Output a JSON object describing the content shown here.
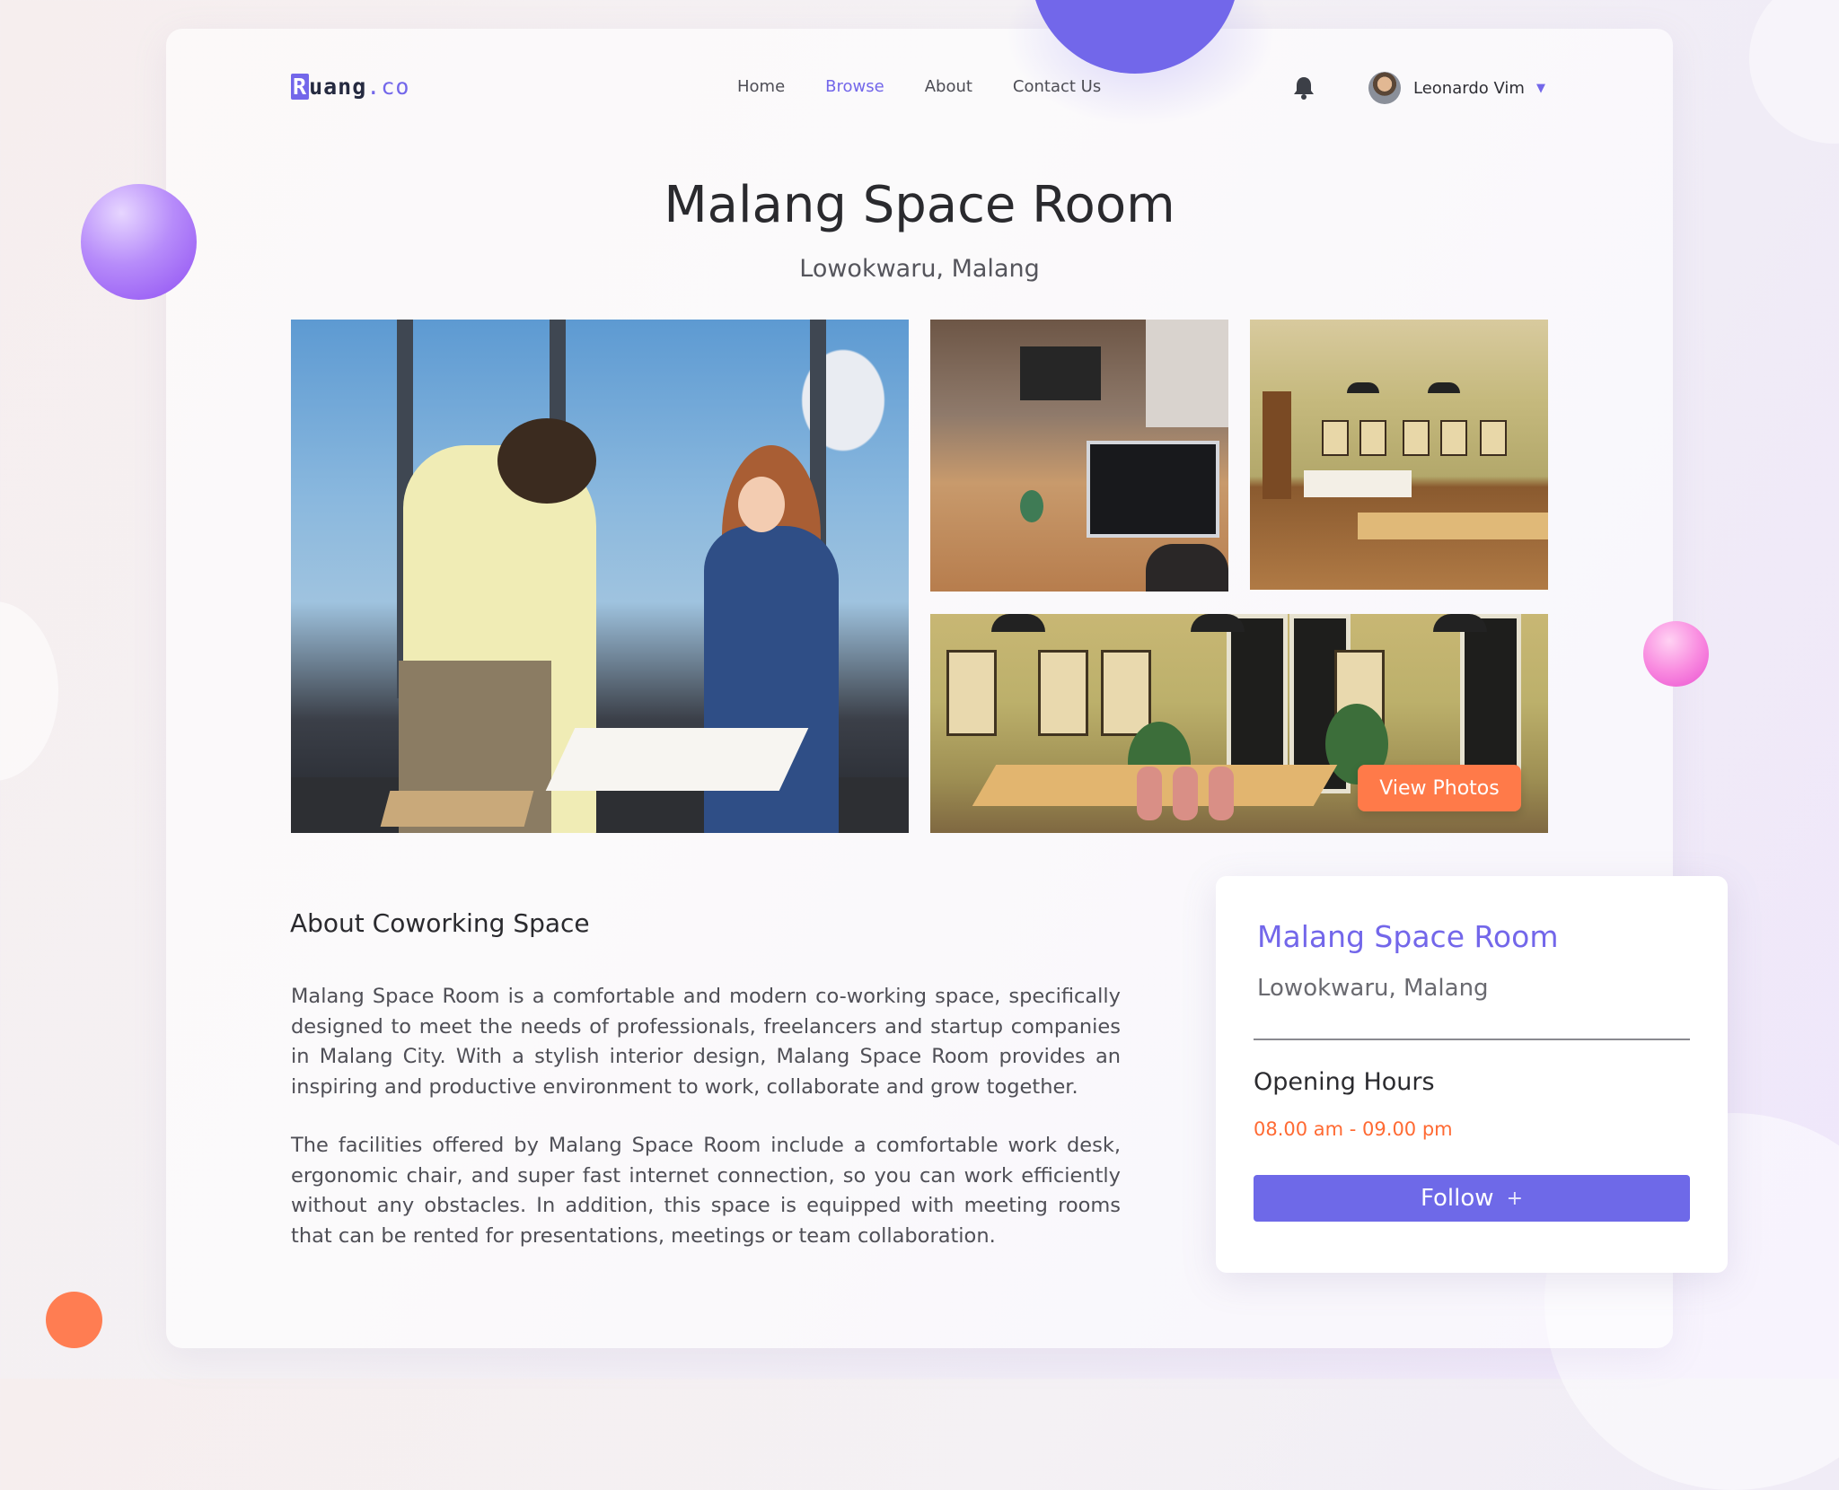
{
  "brand": {
    "logo_first": "R",
    "logo_mid": "uang",
    "logo_end": ".co"
  },
  "nav": {
    "links": [
      "Home",
      "Browse",
      "About",
      "Contact Us"
    ],
    "active": "Browse"
  },
  "user": {
    "name": "Leonardo Vim",
    "caret": "▼"
  },
  "listing": {
    "title": "Malang Space Room",
    "location": "Lowokwaru, Malang"
  },
  "gallery": {
    "view_photos_label": "View Photos"
  },
  "about": {
    "heading": "About Coworking Space",
    "paragraph_1": "Malang Space Room is a comfortable and modern co-working space, specifically designed to meet the needs of professionals, freelancers and startup companies in Malang City. With a stylish interior design, Malang Space Room provides an inspiring and productive environment to work, collaborate and grow together.",
    "paragraph_2": "The facilities offered by Malang Space Room include a comfortable work desk, ergonomic chair, and super fast internet connection, so you can work efficiently without any obstacles. In addition, this space is equipped with meeting rooms that can be rented for presentations, meetings or team collaboration."
  },
  "info_card": {
    "name": "Malang Space Room",
    "location": "Lowokwaru, Malang",
    "hours_label": "Opening Hours",
    "hours": "08.00 am - 09.00 pm",
    "follow_label": "Follow",
    "follow_icon": "+"
  },
  "colors": {
    "accent": "#7367ea",
    "orange": "#ff7a49",
    "text": "#2b2b2b"
  },
  "icons": {
    "bell": "bell-icon",
    "caret": "chevron-down-icon",
    "plus": "plus-icon"
  }
}
